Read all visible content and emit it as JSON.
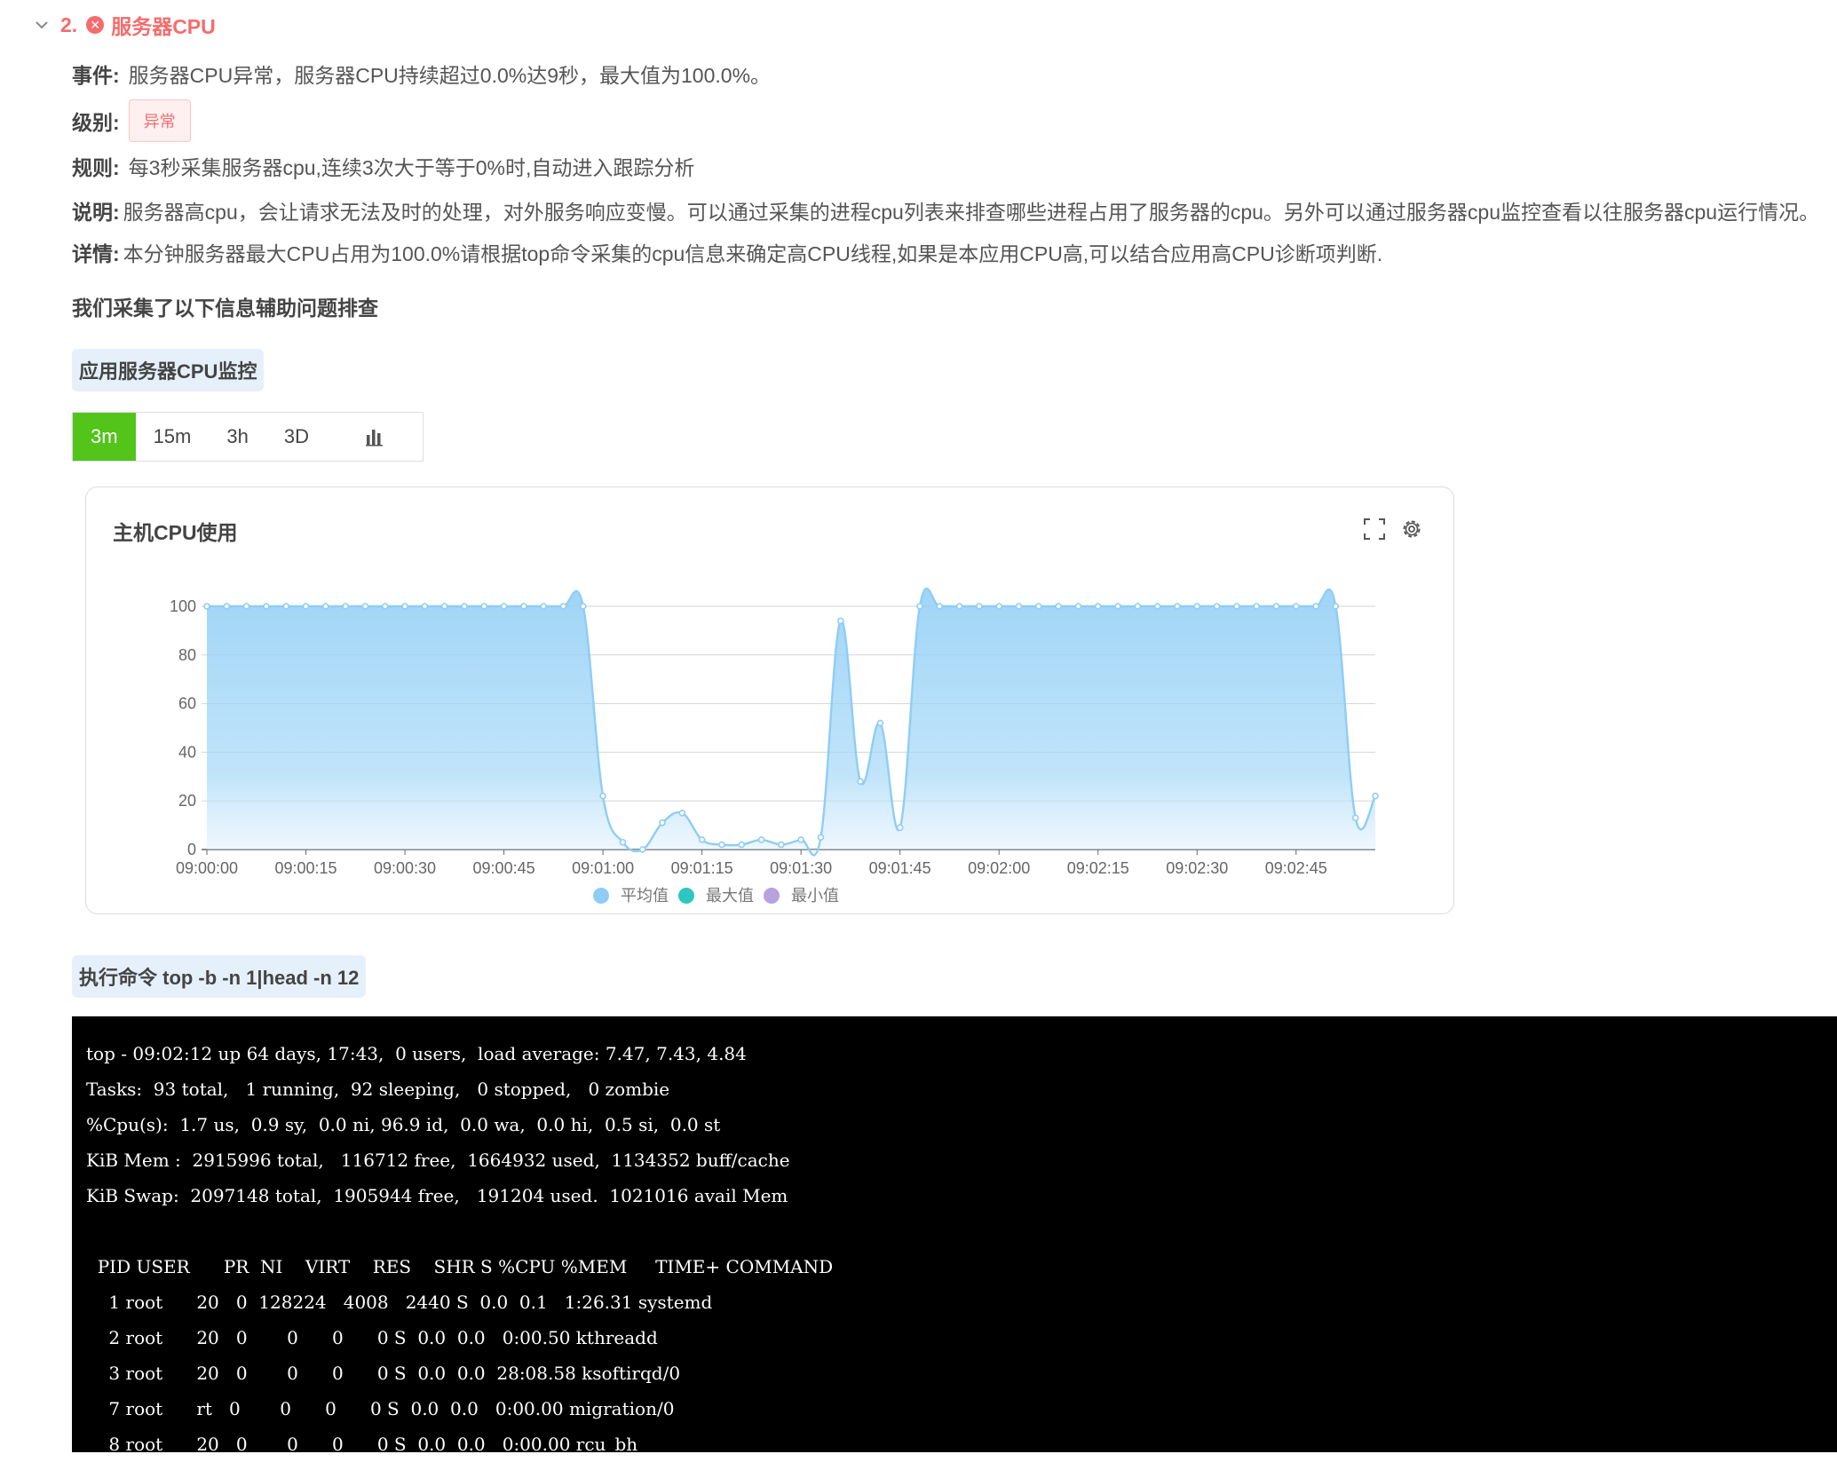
{
  "section": {
    "number": "2.",
    "title": "服务器CPU"
  },
  "event": {
    "label": "事件:",
    "text": "服务器CPU异常，服务器CPU持续超过0.0%达9秒，最大值为100.0%。"
  },
  "level": {
    "label": "级别:",
    "badge": "异常"
  },
  "rule": {
    "label": "规则:",
    "text": "每3秒采集服务器cpu,连续3次大于等于0%时,自动进入跟踪分析"
  },
  "desc": {
    "label": "说明:",
    "text": "服务器高cpu，会让请求无法及时的处理，对外服务响应变慢。可以通过采集的进程cpu列表来排查哪些进程占用了服务器的cpu。另外可以通过服务器cpu监控查看以往服务器cpu运行情况。"
  },
  "detail": {
    "label": "详情:",
    "text": "本分钟服务器最大CPU占用为100.0%请根据top命令采集的cpu信息来确定高CPU线程,如果是本应用CPU高,可以结合应用高CPU诊断项判断."
  },
  "helper_text": "我们采集了以下信息辅助问题排查",
  "monitor_pill": "应用服务器CPU监控",
  "tabs": [
    "3m",
    "15m",
    "3h",
    "3D"
  ],
  "chart_title": "主机CPU使用",
  "colors": {
    "accent": "#52c41a",
    "error": "#f56c6c",
    "avg": "#8fcdf5",
    "max": "#2ec7c0",
    "min": "#b6a2de"
  },
  "chart_data": {
    "type": "area",
    "title": "主机CPU使用",
    "ylim": [
      0,
      100
    ],
    "yticks": [
      0,
      20,
      40,
      60,
      80,
      100
    ],
    "xticks": [
      "09:00:00",
      "09:00:15",
      "09:00:30",
      "09:00:45",
      "09:01:00",
      "09:01:15",
      "09:01:30",
      "09:01:45",
      "09:02:00",
      "09:02:15",
      "09:02:30",
      "09:02:45"
    ],
    "grid": true,
    "legend_position": "bottom",
    "legend": [
      "平均值",
      "最大值",
      "最小值"
    ],
    "series": [
      {
        "name": "平均值",
        "x_seconds_from_start": [
          0,
          3,
          6,
          9,
          12,
          15,
          18,
          21,
          24,
          27,
          30,
          33,
          36,
          39,
          42,
          45,
          48,
          51,
          54,
          57,
          60,
          63,
          66,
          69,
          72,
          75,
          78,
          81,
          84,
          87,
          90,
          93,
          96,
          99,
          102,
          105,
          108,
          111,
          114,
          117,
          120,
          123,
          126,
          129,
          132,
          135,
          138,
          141,
          144,
          147,
          150,
          153,
          156,
          159,
          162,
          165,
          168,
          171,
          174,
          177
        ],
        "values": [
          100,
          100,
          100,
          100,
          100,
          100,
          100,
          100,
          100,
          100,
          100,
          100,
          100,
          100,
          100,
          100,
          100,
          100,
          100,
          100,
          22,
          3,
          0,
          11,
          15,
          4,
          2,
          2,
          4,
          2,
          4,
          5,
          94,
          28,
          52,
          9,
          100,
          100,
          100,
          100,
          100,
          100,
          100,
          100,
          100,
          100,
          100,
          100,
          100,
          100,
          100,
          100,
          100,
          100,
          100,
          100,
          100,
          100,
          13,
          22
        ]
      }
    ]
  },
  "command_pill": "执行命令 top -b -n 1|head -n 12",
  "terminal_lines": [
    "top - 09:02:12 up 64 days, 17:43,  0 users,  load average: 7.47, 7.43, 4.84",
    "Tasks:  93 total,   1 running,  92 sleeping,   0 stopped,   0 zombie",
    "%Cpu(s):  1.7 us,  0.9 sy,  0.0 ni, 96.9 id,  0.0 wa,  0.0 hi,  0.5 si,  0.0 st",
    "KiB Mem :  2915996 total,   116712 free,  1664932 used,  1134352 buff/cache",
    "KiB Swap:  2097148 total,  1905944 free,   191204 used.  1021016 avail Mem",
    "",
    "  PID USER      PR  NI    VIRT    RES    SHR S %CPU %MEM     TIME+ COMMAND",
    "    1 root      20   0  128224   4008   2440 S  0.0  0.1   1:26.31 systemd",
    "    2 root      20   0       0      0      0 S  0.0  0.0   0:00.50 kthreadd",
    "    3 root      20   0       0      0      0 S  0.0  0.0  28:08.58 ksoftirqd/0",
    "    7 root      rt   0       0      0      0 S  0.0  0.0   0:00.00 migration/0",
    "    8 root      20   0       0      0      0 S  0.0  0.0   0:00.00 rcu_bh"
  ]
}
